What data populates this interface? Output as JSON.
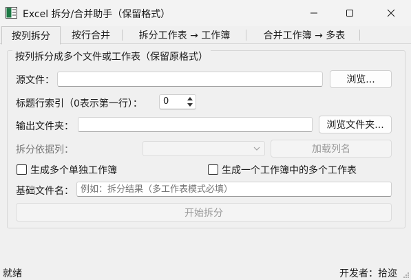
{
  "window": {
    "title": "Excel 拆分/合并助手（保留格式）"
  },
  "tabs": [
    {
      "label": "按列拆分",
      "active": true
    },
    {
      "label": "按行合并",
      "active": false
    },
    {
      "label": "拆分工作表 → 工作簿",
      "active": false
    },
    {
      "label": "合并工作簿 → 多表",
      "active": false
    }
  ],
  "group": {
    "title": "按列拆分成多个文件或工作表（保留原格式）"
  },
  "form": {
    "source_label": "源文件：",
    "source_value": "",
    "browse_label": "浏览...",
    "header_index_label": "标题行索引（0表示第一行）：",
    "header_index_value": "0",
    "output_label": "输出文件夹：",
    "output_value": "",
    "browse_folder_label": "浏览文件夹...",
    "split_column_label": "拆分依据列：",
    "split_column_value": "",
    "load_columns_label": "加载列名",
    "option_multi_workbooks": "生成多个单独工作簿",
    "option_multi_sheets": "生成一个工作簿中的多个工作表",
    "option_multi_workbooks_checked": false,
    "option_multi_sheets_checked": false,
    "base_name_label": "基础文件名：",
    "base_name_placeholder": "例如：拆分结果（多工作表模式必填）",
    "start_label": "开始拆分"
  },
  "status": {
    "left": "就绪",
    "right": "开发者：拾迩"
  },
  "colors": {
    "window_bg": "#f0f0f0",
    "input_border": "#cfcfcf",
    "disabled_text": "#9a9a9a",
    "icon_green": "#1d7a45"
  }
}
